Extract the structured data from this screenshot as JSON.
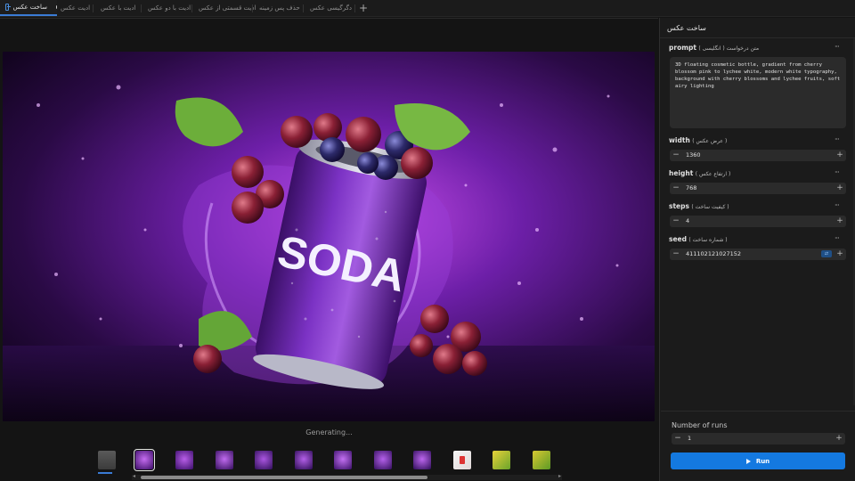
{
  "tabs": [
    {
      "label": "ساخت عکس",
      "active": true
    },
    {
      "label": "ادیت عکس"
    },
    {
      "label": "ادیت با عکس"
    },
    {
      "label": "ادیت با دو عکس"
    },
    {
      "label": "ادیت قسمتی از عکس"
    },
    {
      "label": "حذف پس زمینه"
    },
    {
      "label": "دگرگیسی عکس"
    }
  ],
  "canvas": {
    "status": "Generating...",
    "image_text": "SODA",
    "thumbnail_count": 12
  },
  "panel": {
    "title": "ساخت عکس",
    "prompt": {
      "label": "prompt",
      "sublabel": "( متن درخواست ( انگلیسی",
      "value": "3D floating cosmetic bottle, gradient from cherry blossom pink to lychee white, modern white typography, background with cherry blossoms and lychee fruits, soft airy lighting"
    },
    "width": {
      "label": "width",
      "sublabel": "( عرض عکس )",
      "value": "1360"
    },
    "height": {
      "label": "height",
      "sublabel": "( ارتفاع عکس )",
      "value": "768"
    },
    "steps": {
      "label": "steps",
      "sublabel": "( کیفیت ساخت )",
      "value": "4"
    },
    "seed": {
      "label": "seed",
      "sublabel": "( شماره ساخت )",
      "value": "411102121027152"
    },
    "more_icon": "···",
    "runs_label": "Number of runs",
    "runs_value": "1",
    "run_label": "Run"
  },
  "colors": {
    "accent": "#1479e0",
    "background": "#141414",
    "panel": "#1b1b1b"
  }
}
